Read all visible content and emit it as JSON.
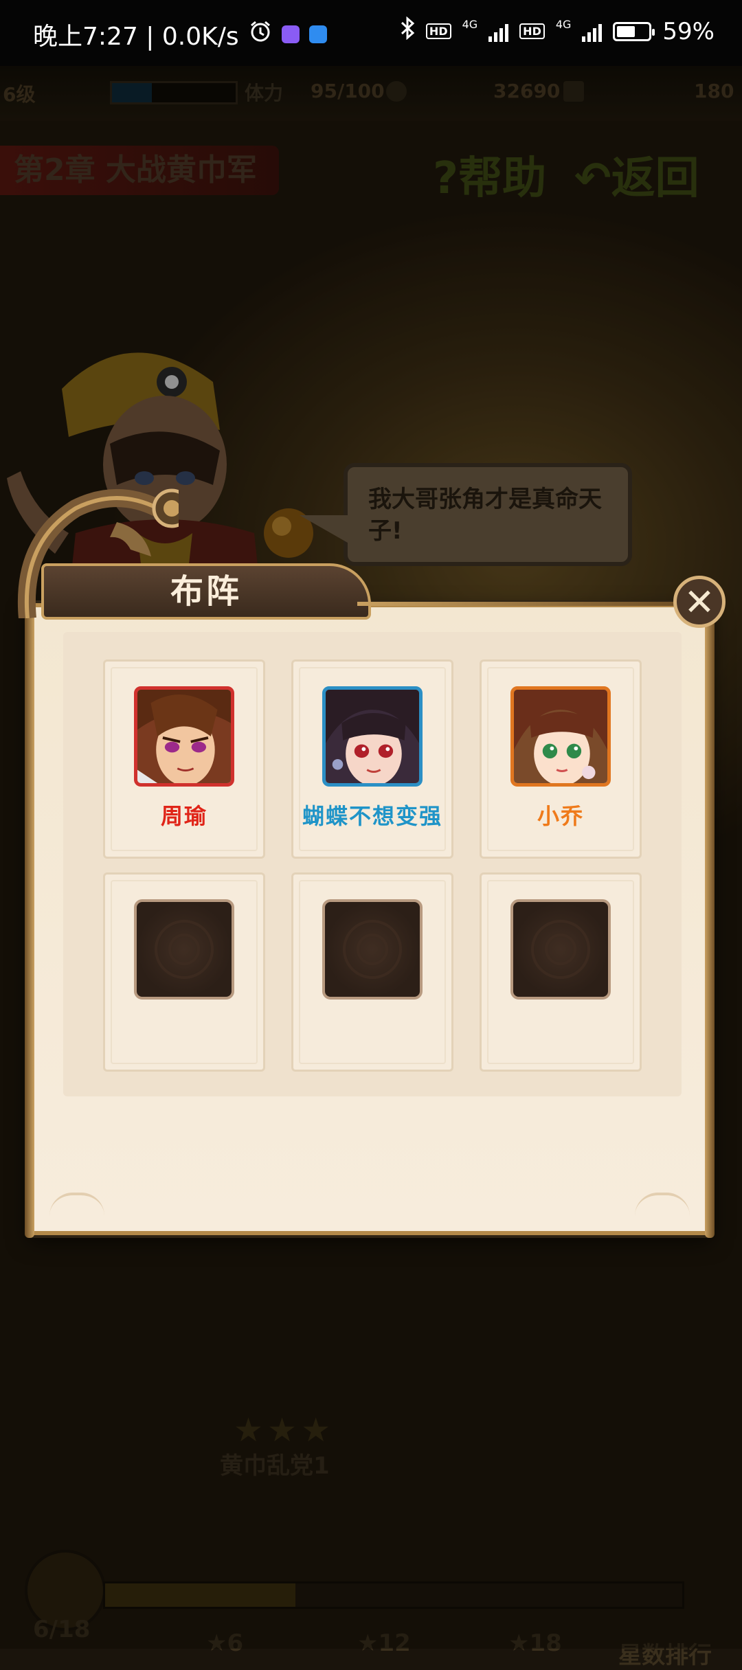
{
  "status_bar": {
    "time_speed": "晚上7:27 | 0.0K/s",
    "hd1": "HD",
    "net1": "4G",
    "hd2": "HD",
    "net2": "4G",
    "battery_percent": "59%",
    "battery_level": 0.59
  },
  "game": {
    "player_level": "6级",
    "stamina_icon_text": "体力",
    "stamina": "95/100",
    "coins": "32690",
    "gold": "180",
    "chapter_title": "第2章  大战黄巾军",
    "help_label": "?帮助",
    "back_label": "返回",
    "speech": "我大哥张角才是真命天子!",
    "node_name": "黄巾乱党1",
    "node_stars": 3,
    "progress_text": "6/18",
    "progress_fraction": 0.33,
    "milestones": [
      "6",
      "12",
      "18"
    ],
    "ranking_label": "星数排行"
  },
  "lineup_dialog": {
    "title": "布阵",
    "close_icon": "close-icon",
    "heroes": [
      {
        "name": "周瑜",
        "color": "#e02418",
        "frame": "#d0312d"
      },
      {
        "name": "蝴蝶不想变强",
        "color": "#1f94c8",
        "frame": "#2b8fc5"
      },
      {
        "name": "小乔",
        "color": "#ef7a1a",
        "frame": "#e07620"
      }
    ],
    "empty_slots": 3
  }
}
